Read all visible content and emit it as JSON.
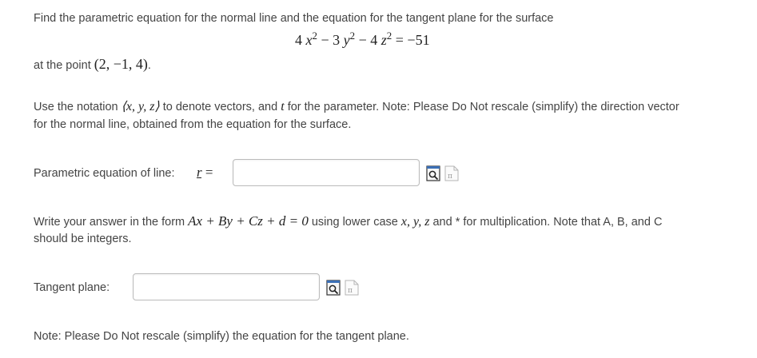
{
  "problem": {
    "intro": "Find the parametric equation for the normal line and the equation for the tangent plane for the surface",
    "equation": {
      "t1_coef": "4",
      "t1_var": "x",
      "t1_exp": "2",
      "op1": " − 3 ",
      "t2_var": "y",
      "t2_exp": "2",
      "op2": " − 4 ",
      "t3_var": "z",
      "t3_exp": "2",
      "rhs": " = −51"
    },
    "point_prefix": "at the point ",
    "point_value": "(2,  −1,  4)",
    "point_suffix": "."
  },
  "notation": {
    "p1": "Use the notation ",
    "vector": "⟨x, y, z⟩",
    "p2": " to denote vectors, and ",
    "param": "t",
    "p3": " for the parameter. Note: Please Do Not rescale (simplify) the direction vector",
    "line2": "for the normal line, obtained from the equation for the surface."
  },
  "line_answer": {
    "label": "Parametric equation of line:",
    "var": "r",
    "eq": " =",
    "value": "",
    "preview_icon": "preview-icon",
    "equation_editor_icon": "equation-editor-icon"
  },
  "form_note": {
    "p1": "Write your answer in the form ",
    "form": "Ax + By + Cz + d = 0",
    "p2": " using lower case ",
    "vars": "x, y, z",
    "p3": " and * for multiplication. Note that A, B, and C",
    "line2": "should be integers."
  },
  "plane_answer": {
    "label": "Tangent plane:",
    "value": "",
    "preview_icon": "preview-icon",
    "equation_editor_icon": "equation-editor-icon"
  },
  "footer_note": "Note: Please Do Not rescale (simplify) the equation for the tangent plane."
}
